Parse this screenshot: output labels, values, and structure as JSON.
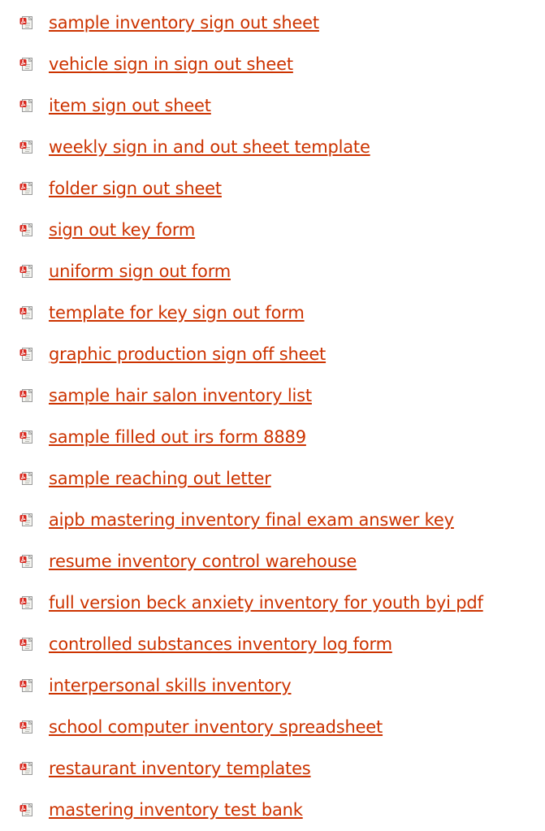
{
  "links": [
    {
      "label": "sample inventory sign out sheet",
      "icon": "pdf-file-icon"
    },
    {
      "label": "vehicle sign in sign out sheet",
      "icon": "pdf-file-icon"
    },
    {
      "label": "item sign out sheet",
      "icon": "pdf-file-icon"
    },
    {
      "label": "weekly sign in and out sheet template",
      "icon": "pdf-file-icon"
    },
    {
      "label": "folder sign out sheet",
      "icon": "pdf-file-icon"
    },
    {
      "label": "sign out key form",
      "icon": "pdf-file-icon"
    },
    {
      "label": "uniform sign out form",
      "icon": "pdf-file-icon"
    },
    {
      "label": "template for key sign out form",
      "icon": "pdf-file-icon"
    },
    {
      "label": "graphic production sign off sheet",
      "icon": "pdf-file-icon"
    },
    {
      "label": "sample hair salon inventory list",
      "icon": "pdf-file-icon"
    },
    {
      "label": "sample filled out irs form 8889",
      "icon": "pdf-file-icon"
    },
    {
      "label": "sample reaching out letter",
      "icon": "pdf-file-icon"
    },
    {
      "label": "aipb mastering inventory final exam answer key",
      "icon": "pdf-file-icon"
    },
    {
      "label": "resume inventory control warehouse",
      "icon": "pdf-file-icon"
    },
    {
      "label": "full version beck anxiety inventory for youth byi pdf",
      "icon": "pdf-file-icon"
    },
    {
      "label": "controlled substances inventory log form",
      "icon": "pdf-file-icon"
    },
    {
      "label": "interpersonal skills inventory",
      "icon": "pdf-file-icon"
    },
    {
      "label": "school computer inventory spreadsheet",
      "icon": "pdf-file-icon"
    },
    {
      "label": "restaurant inventory templates",
      "icon": "pdf-file-icon"
    },
    {
      "label": "mastering inventory test bank",
      "icon": "pdf-file-icon"
    }
  ],
  "colors": {
    "link": "#cc3300",
    "icon_red": "#d9261c",
    "icon_paper": "#f4f4f0",
    "icon_border": "#9a9a9a"
  }
}
